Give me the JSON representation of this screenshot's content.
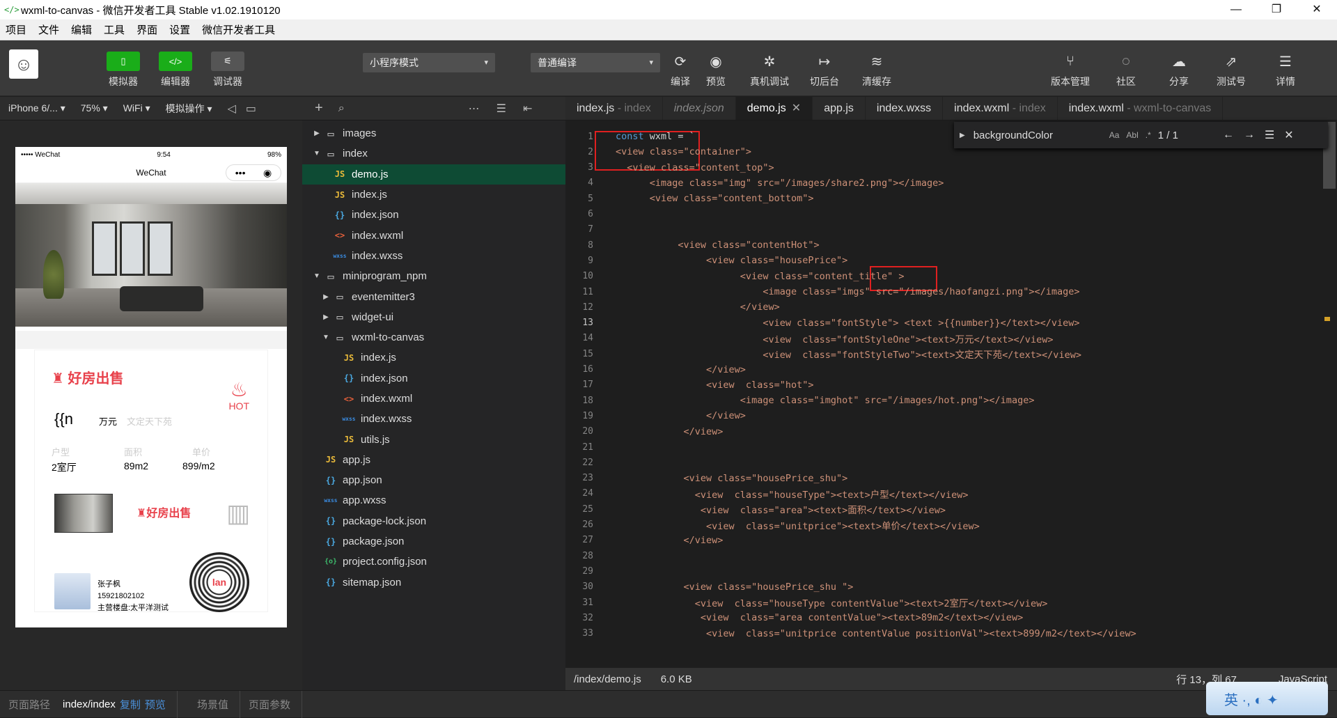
{
  "window": {
    "title": "wxml-to-canvas - 微信开发者工具 Stable v1.02.1910120",
    "min": "—",
    "restore": "❐",
    "close": "✕"
  },
  "menu": [
    "项目",
    "文件",
    "编辑",
    "工具",
    "界面",
    "设置",
    "微信开发者工具"
  ],
  "toolbar": {
    "simulator": "模拟器",
    "editor": "编辑器",
    "debugger": "调试器",
    "mode": "小程序模式",
    "compile_mode": "普通编译",
    "compile": "编译",
    "preview": "预览",
    "remote_debug": "真机调试",
    "background": "切后台",
    "clear_cache": "清缓存",
    "version": "版本管理",
    "community": "社区",
    "share": "分享",
    "test": "测试号",
    "details": "详情"
  },
  "subtoolbar": {
    "device": "iPhone 6/...",
    "zoom": "75%",
    "network": "WiFi",
    "sim_ops": "模拟操作"
  },
  "tabs": [
    {
      "name": "index.js",
      "suffix": " - index"
    },
    {
      "name": "index.json",
      "suffix": ""
    },
    {
      "name": "demo.js",
      "suffix": ""
    },
    {
      "name": "app.js",
      "suffix": ""
    },
    {
      "name": "index.wxss",
      "suffix": ""
    },
    {
      "name": "index.wxml",
      "suffix": " - index"
    },
    {
      "name": "index.wxml",
      "suffix": " - wxml-to-canvas"
    }
  ],
  "phone": {
    "carrier": "••••• WeChat",
    "time": "9:54",
    "battery": "98%",
    "nav_title": "WeChat",
    "capsule_more": "•••",
    "capsule_close": "◉",
    "brand": "好房出售",
    "hot": "HOT",
    "number": "{{n",
    "unit": "万元",
    "location": "文定天下苑",
    "labels": [
      "户型",
      "面积",
      "单价"
    ],
    "values": [
      "2室厅",
      "89m2",
      "899/m2"
    ],
    "brand_small": "好房出售",
    "qr_text": "lan",
    "person_name": "张子枫",
    "person_phone": "15921802102",
    "person_project": "主营楼盘:太平洋测试"
  },
  "files": [
    {
      "indent": 0,
      "arrow": "▶",
      "icon": "▭",
      "type": "folder",
      "name": "images"
    },
    {
      "indent": 0,
      "arrow": "▼",
      "icon": "▭",
      "type": "folder",
      "name": "index"
    },
    {
      "indent": 1,
      "arrow": "",
      "icon": "JS",
      "type": "js",
      "name": "demo.js",
      "selected": true
    },
    {
      "indent": 1,
      "arrow": "",
      "icon": "JS",
      "type": "js",
      "name": "index.js"
    },
    {
      "indent": 1,
      "arrow": "",
      "icon": "{}",
      "type": "json",
      "name": "index.json"
    },
    {
      "indent": 1,
      "arrow": "",
      "icon": "<>",
      "type": "wxml",
      "name": "index.wxml"
    },
    {
      "indent": 1,
      "arrow": "",
      "icon": "wxss",
      "type": "wxss",
      "name": "index.wxss"
    },
    {
      "indent": 0,
      "arrow": "▼",
      "icon": "▭",
      "type": "folder",
      "name": "miniprogram_npm"
    },
    {
      "indent": 1,
      "arrow": "▶",
      "icon": "▭",
      "type": "folder",
      "name": "eventemitter3"
    },
    {
      "indent": 1,
      "arrow": "▶",
      "icon": "▭",
      "type": "folder",
      "name": "widget-ui"
    },
    {
      "indent": 1,
      "arrow": "▼",
      "icon": "▭",
      "type": "folder",
      "name": "wxml-to-canvas"
    },
    {
      "indent": 2,
      "arrow": "",
      "icon": "JS",
      "type": "js",
      "name": "index.js"
    },
    {
      "indent": 2,
      "arrow": "",
      "icon": "{}",
      "type": "json",
      "name": "index.json"
    },
    {
      "indent": 2,
      "arrow": "",
      "icon": "<>",
      "type": "wxml",
      "name": "index.wxml"
    },
    {
      "indent": 2,
      "arrow": "",
      "icon": "wxss",
      "type": "wxss",
      "name": "index.wxss"
    },
    {
      "indent": 2,
      "arrow": "",
      "icon": "JS",
      "type": "js",
      "name": "utils.js"
    },
    {
      "indent": 0,
      "arrow": "",
      "icon": "JS",
      "type": "js",
      "name": "app.js"
    },
    {
      "indent": 0,
      "arrow": "",
      "icon": "{}",
      "type": "json",
      "name": "app.json"
    },
    {
      "indent": 0,
      "arrow": "",
      "icon": "wxss",
      "type": "wxss",
      "name": "app.wxss"
    },
    {
      "indent": 0,
      "arrow": "",
      "icon": "{}",
      "type": "json",
      "name": "package-lock.json"
    },
    {
      "indent": 0,
      "arrow": "",
      "icon": "{}",
      "type": "json",
      "name": "package.json"
    },
    {
      "indent": 0,
      "arrow": "",
      "icon": "{o}",
      "type": "cfg",
      "name": "project.config.json"
    },
    {
      "indent": 0,
      "arrow": "",
      "icon": "{}",
      "type": "json",
      "name": "sitemap.json"
    }
  ],
  "code": [
    "const wxml = `",
    "<view class=\"container\">",
    "  <view class=\"content_top\">",
    "      <image class=\"img\" src=\"/images/share2.png\"></image>",
    "      <view class=\"content_bottom\">",
    "",
    "",
    "           <view class=\"contentHot\">",
    "                <view class=\"housePrice\">",
    "                      <view class=\"content_title\" >",
    "                          <image class=\"imgs\" src=\"/images/haofangzi.png\"></image>",
    "                      </view>",
    "                          <view class=\"fontStyle\"> <text >{{number}}</text></view>",
    "                          <view  class=\"fontStyleOne\"><text>万元</text></view>",
    "                          <view  class=\"fontStyleTwo\"><text>文定天下苑</text></view>",
    "                </view>",
    "                <view  class=\"hot\">",
    "                      <image class=\"imghot\" src=\"/images/hot.png\"></image>",
    "                </view>",
    "            </view>",
    "",
    "",
    "            <view class=\"housePrice_shu\">",
    "              <view  class=\"houseType\"><text>户型</text></view>",
    "               <view  class=\"area\"><text>面积</text></view>",
    "                <view  class=\"unitprice\"><text>单价</text></view>",
    "            </view>",
    "",
    "",
    "            <view class=\"housePrice_shu \">",
    "              <view  class=\"houseType contentValue\"><text>2室厅</text></view>",
    "               <view  class=\"area contentValue\"><text>89m2</text></view>",
    "                <view  class=\"unitprice contentValue positionVal\"><text>899/m2</text></view>"
  ],
  "current_line": 13,
  "find": {
    "query": "backgroundColor",
    "aa": "Aa",
    "ab": "Abl",
    "regex": ".*",
    "count": "1 / 1"
  },
  "status": {
    "path": "/index/demo.js",
    "size": "6.0 KB",
    "cursor": "行 13，列 67",
    "lang": "JavaScript"
  },
  "bottom": {
    "path_label": "页面路径",
    "path": "index/index",
    "copy": "复制",
    "preview": "预览",
    "scene": "场景值",
    "params": "页面参数"
  },
  "ime": {
    "label": "英 ·, ◐ ✦"
  }
}
